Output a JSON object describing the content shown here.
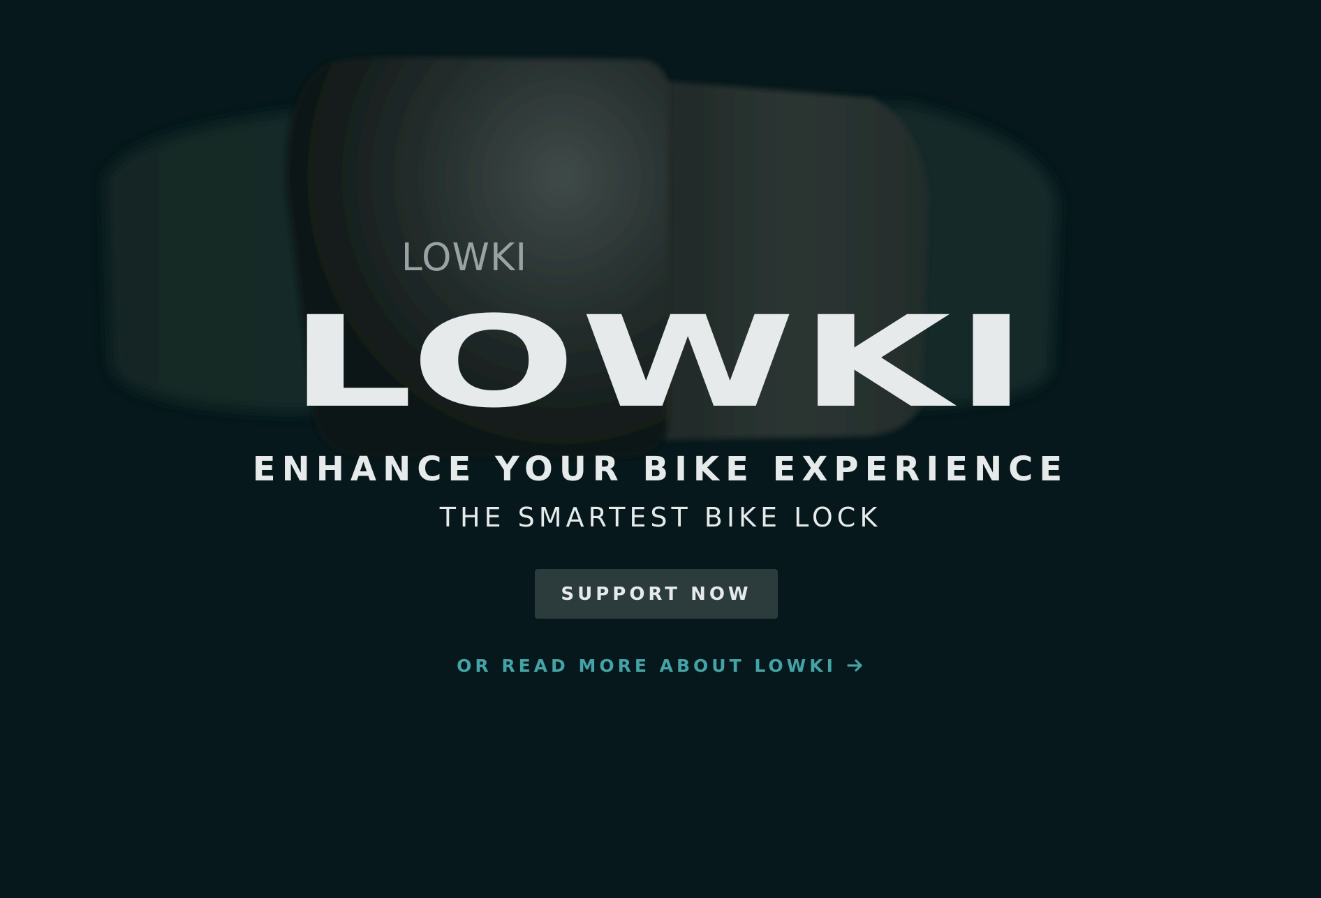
{
  "hero": {
    "product_logo": "LOWKI",
    "brand_title": "LOWKI",
    "tagline": "ENHANCE YOUR BIKE EXPERIENCE",
    "subtitle": "THE SMARTEST BIKE LOCK"
  },
  "cta": {
    "support_label": "SUPPORT NOW",
    "read_more_label": "OR READ MORE ABOUT LOWKI",
    "read_more_icon": "arrow-right-icon"
  },
  "colors": {
    "background": "#06181b",
    "text": "#e6eaea",
    "button_bg": "#2c3b3c",
    "link_accent": "#44a3a7"
  }
}
